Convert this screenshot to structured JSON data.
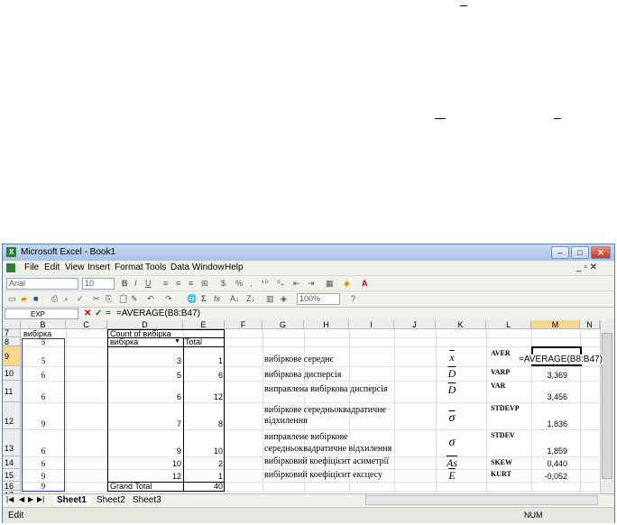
{
  "window": {
    "title": "Microsoft Excel - Book1"
  },
  "menu": [
    "File",
    "Edit",
    "View",
    "Insert",
    "Format",
    "Tools",
    "Data",
    "Window",
    "Help"
  ],
  "toolbar": {
    "font_name": "Arial",
    "font_size": "10",
    "zoom": "100%"
  },
  "formula_bar": {
    "name_box": "EXP",
    "cancel": "✕",
    "enter": "✓",
    "equals": "=",
    "formula": "=AVERAGE(B8:B47)"
  },
  "columns": [
    "B",
    "C",
    "D",
    "E",
    "F",
    "G",
    "H",
    "I",
    "J",
    "K",
    "L",
    "M",
    "N"
  ],
  "rows": [
    "7",
    "8",
    "9",
    "10",
    "11",
    "12",
    "13",
    "14",
    "15",
    "16",
    "17"
  ],
  "pivot": {
    "title": "Count of вибірка",
    "row_header": "вибірка",
    "total_header": "Total",
    "grand_total_label": "Grand Total",
    "grand_total": "40",
    "rows": [
      {
        "value": "3",
        "count": "1"
      },
      {
        "value": "5",
        "count": "6"
      },
      {
        "value": "6",
        "count": "12"
      },
      {
        "value": "7",
        "count": "8"
      },
      {
        "value": "9",
        "count": "10"
      },
      {
        "value": "10",
        "count": "2"
      },
      {
        "value": "12",
        "count": "1"
      }
    ]
  },
  "col_b": {
    "header": "вибірка",
    "values": [
      "5",
      "5",
      "6",
      "6",
      "9",
      "6",
      "6",
      "9",
      "9"
    ]
  },
  "stats": [
    {
      "label": "вибіркове середнє",
      "symbol": "x",
      "fn": "AVER",
      "value": "=AVERAGE(B8:B47)"
    },
    {
      "label": "вибіркова дисперсія",
      "symbol": "D",
      "fn": "VARP",
      "value": "3,369"
    },
    {
      "label": "виправлена вибіркова дисперсія",
      "symbol": "D",
      "fn": "VAR",
      "value": "3,456"
    },
    {
      "label": "вибіркове середньоквадратичне відхилення",
      "symbol": "σ",
      "fn": "STDEVP",
      "value": "1,836"
    },
    {
      "label": "виправлене вибіркове середньоквадратичне відхилення",
      "symbol": "σ",
      "fn": "STDEV",
      "value": "1,859"
    },
    {
      "label": "вибірковий коефіцієнт асиметрії",
      "symbol": "As",
      "fn": "SKEW",
      "value": "0,440"
    },
    {
      "label": "вибірковий коефіцієнт ексцесу",
      "symbol": "E",
      "fn": "KURT",
      "value": "-0,052"
    }
  ],
  "sheet_tabs": [
    "Sheet1",
    "Sheet2",
    "Sheet3"
  ],
  "status": {
    "mode": "Edit",
    "num": "NUM"
  }
}
